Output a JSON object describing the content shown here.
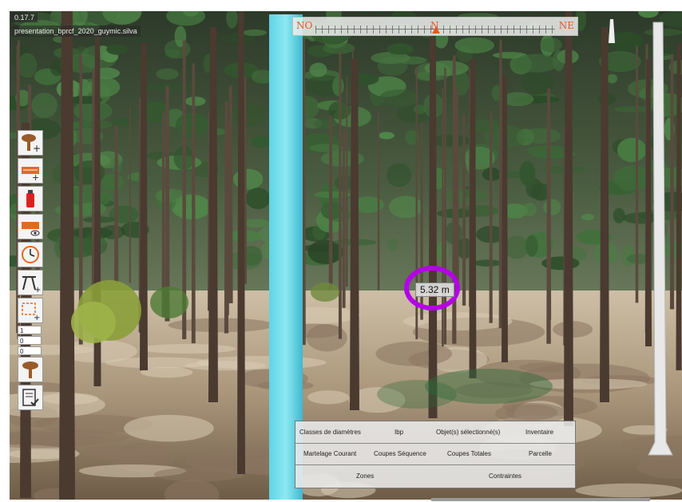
{
  "hud": {
    "version": "0.17.7",
    "filename": "presentation_bprcf_2020_guymic.silva"
  },
  "compass": {
    "left_label": "NO",
    "center_label": "N",
    "right_label": "NE",
    "accent_color": "#e25a23"
  },
  "toolbar": {
    "items": [
      {
        "icon": "tree-add-icon"
      },
      {
        "icon": "measure-add-icon"
      },
      {
        "icon": "spray-can-icon"
      },
      {
        "icon": "measure-view-icon"
      },
      {
        "icon": "clock-icon"
      },
      {
        "icon": "easel-add-icon"
      },
      {
        "icon": "selection-add-icon"
      }
    ],
    "field_1": "1",
    "field_2": "0",
    "field_3": "0",
    "extra_items": [
      {
        "icon": "tree-icon"
      },
      {
        "icon": "checklist-icon"
      }
    ]
  },
  "measurement": {
    "label": "5.32 m",
    "highlight_color": "#b400e8"
  },
  "menu": {
    "row1": [
      "Classes de diamètres",
      "Ibp",
      "Objet(s) sélectionné(s)",
      "Inventaire"
    ],
    "row2": [
      "Martelage Courant",
      "Coupes Séquence",
      "Coupes Totales",
      "Parcelle"
    ],
    "row3": [
      "Zones",
      "Contraintes"
    ]
  }
}
